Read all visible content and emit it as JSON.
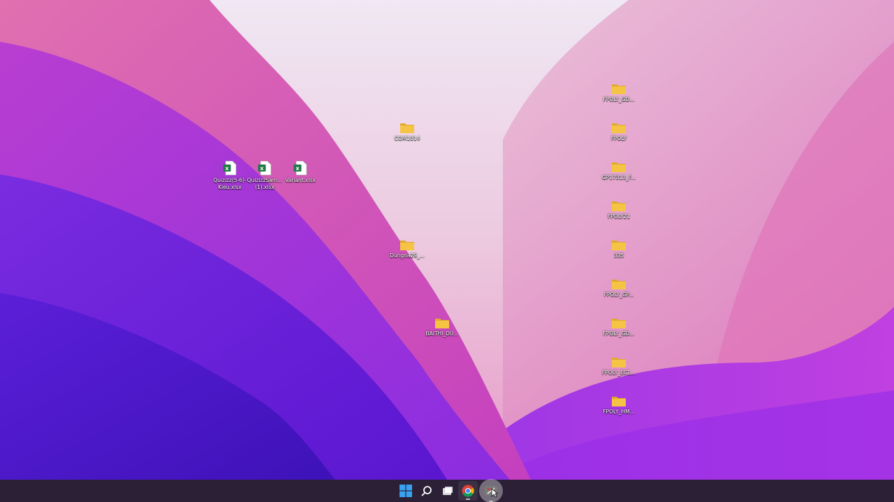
{
  "desktop": {
    "excel_files": [
      {
        "label": "Quizizz(5-6)-Kieu.xlsx",
        "icon": "excel-file-icon"
      },
      {
        "label": "QuizizzSam... (1).xlsx",
        "icon": "excel-file-icon"
      },
      {
        "label": "Variant.xlsx",
        "icon": "excel-file-icon"
      }
    ],
    "center_folders": [
      {
        "label": "COM1014",
        "icon": "folder-icon"
      },
      {
        "label": "Dungna29_...",
        "icon": "folder-icon"
      },
      {
        "label": "BAITHI_DU...",
        "icon": "folder-icon"
      }
    ],
    "right_folders": [
      {
        "label": "FPOLY_GD...",
        "icon": "folder-icon"
      },
      {
        "label": "FPOLY",
        "icon": "folder-icon"
      },
      {
        "label": "GP17313_F...",
        "icon": "folder-icon"
      },
      {
        "label": "FPOLY21",
        "icon": "folder-icon"
      },
      {
        "label": "335",
        "icon": "folder-icon"
      },
      {
        "label": "FPOLY_GP...",
        "icon": "folder-icon"
      },
      {
        "label": "FPOLY_GD...",
        "icon": "folder-icon"
      },
      {
        "label": "FPOLY_EC1...",
        "icon": "folder-icon"
      },
      {
        "label": "FPOLY_HM...",
        "icon": "folder-icon"
      }
    ]
  },
  "taskbar": {
    "buttons": [
      {
        "icon": "windows-start-icon"
      },
      {
        "icon": "search-icon"
      },
      {
        "icon": "task-view-icon"
      },
      {
        "icon": "chrome-icon"
      },
      {
        "icon": "recording-app-icon"
      }
    ]
  },
  "colors": {
    "taskbar_bg": "#2b2036",
    "folder_yellow": "#f6c445",
    "excel_green": "#1d7a45"
  }
}
